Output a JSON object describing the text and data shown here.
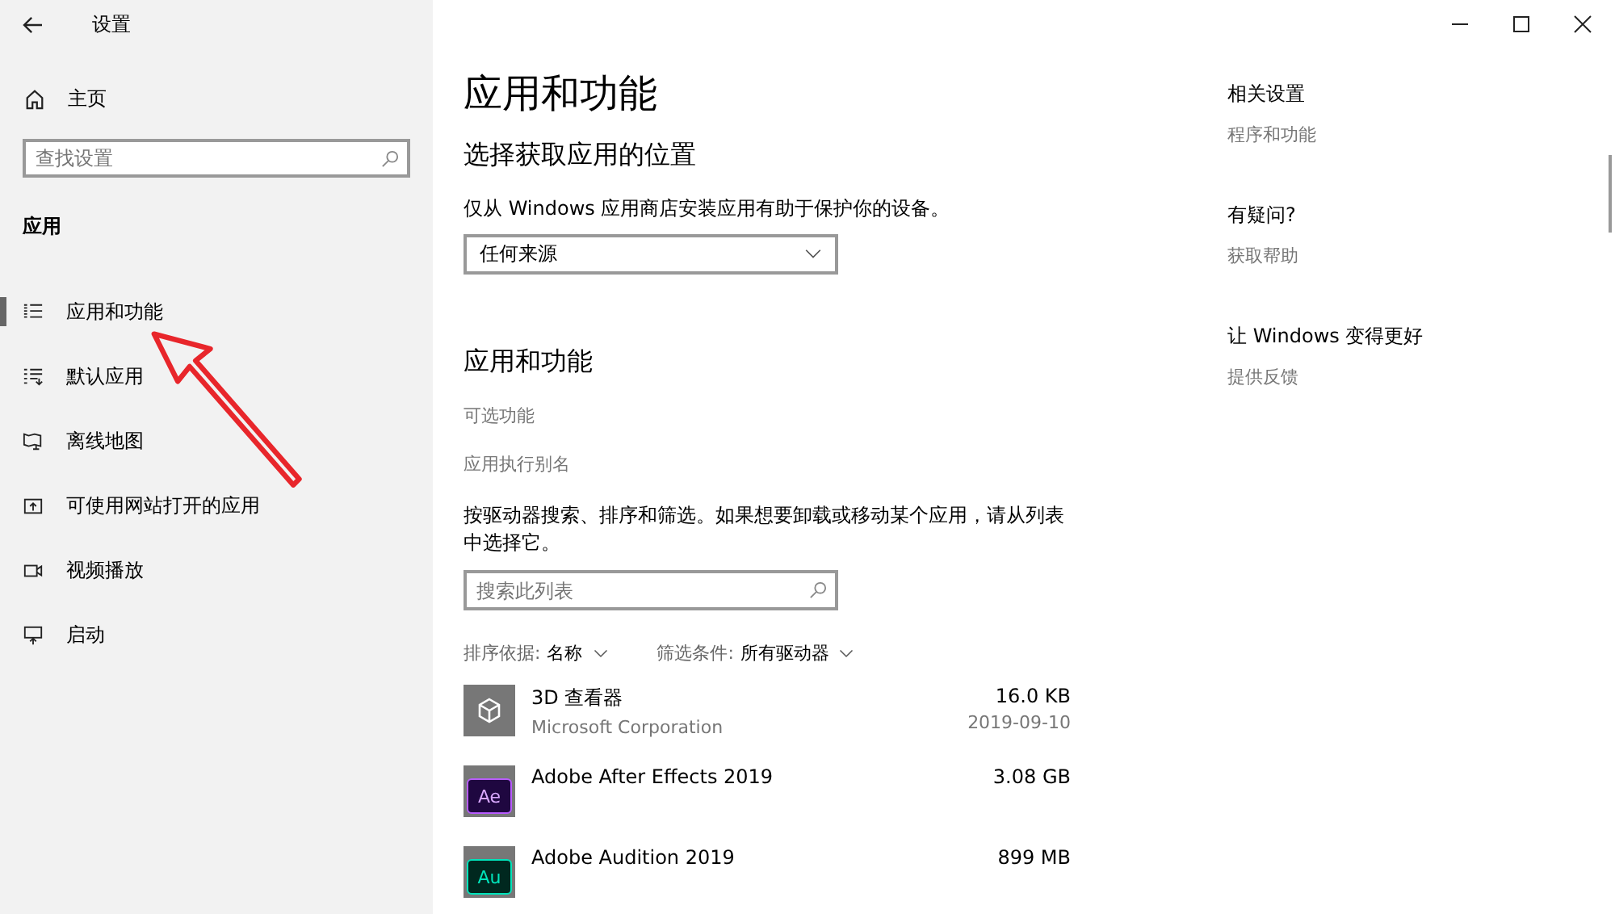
{
  "window": {
    "title": "设置"
  },
  "sidebar": {
    "home": "主页",
    "search": {
      "placeholder": "查找设置"
    },
    "section": "应用",
    "items": [
      {
        "label": "应用和功能",
        "kind": "list",
        "selected": true
      },
      {
        "label": "默认应用",
        "kind": "defaults",
        "selected": false
      },
      {
        "label": "离线地图",
        "kind": "map",
        "selected": false
      },
      {
        "label": "可使用网站打开的应用",
        "kind": "web",
        "selected": false
      },
      {
        "label": "视频播放",
        "kind": "video",
        "selected": false
      },
      {
        "label": "启动",
        "kind": "startup",
        "selected": false
      }
    ]
  },
  "main": {
    "title": "应用和功能",
    "source": {
      "heading": "选择获取应用的位置",
      "description": "仅从 Windows 应用商店安装应用有助于保护你的设备。",
      "dropdown": "任何来源"
    },
    "apps": {
      "heading": "应用和功能",
      "links": [
        "可选功能",
        "应用执行别名"
      ],
      "description": "按驱动器搜索、排序和筛选。如果想要卸载或移动某个应用，请从列表中选择它。",
      "search": {
        "placeholder": "搜索此列表"
      },
      "sort": {
        "label": "排序依据:",
        "value": "名称"
      },
      "filter": {
        "label": "筛选条件:",
        "value": "所有驱动器"
      },
      "rows": [
        {
          "kind": "viewer3d",
          "name": "3D 查看器",
          "publisher": "Microsoft Corporation",
          "size": "16.0 KB",
          "date": "2019-09-10"
        },
        {
          "kind": "ae",
          "icon_text": "Ae",
          "name": "Adobe After Effects 2019",
          "size": "3.08 GB"
        },
        {
          "kind": "au",
          "icon_text": "Au",
          "name": "Adobe Audition 2019",
          "size": "899 MB"
        }
      ]
    }
  },
  "related": [
    {
      "heading": "相关设置",
      "link": "程序和功能"
    },
    {
      "heading": "有疑问?",
      "link": "获取帮助"
    },
    {
      "heading": "让 Windows 变得更好",
      "link": "提供反馈"
    }
  ]
}
